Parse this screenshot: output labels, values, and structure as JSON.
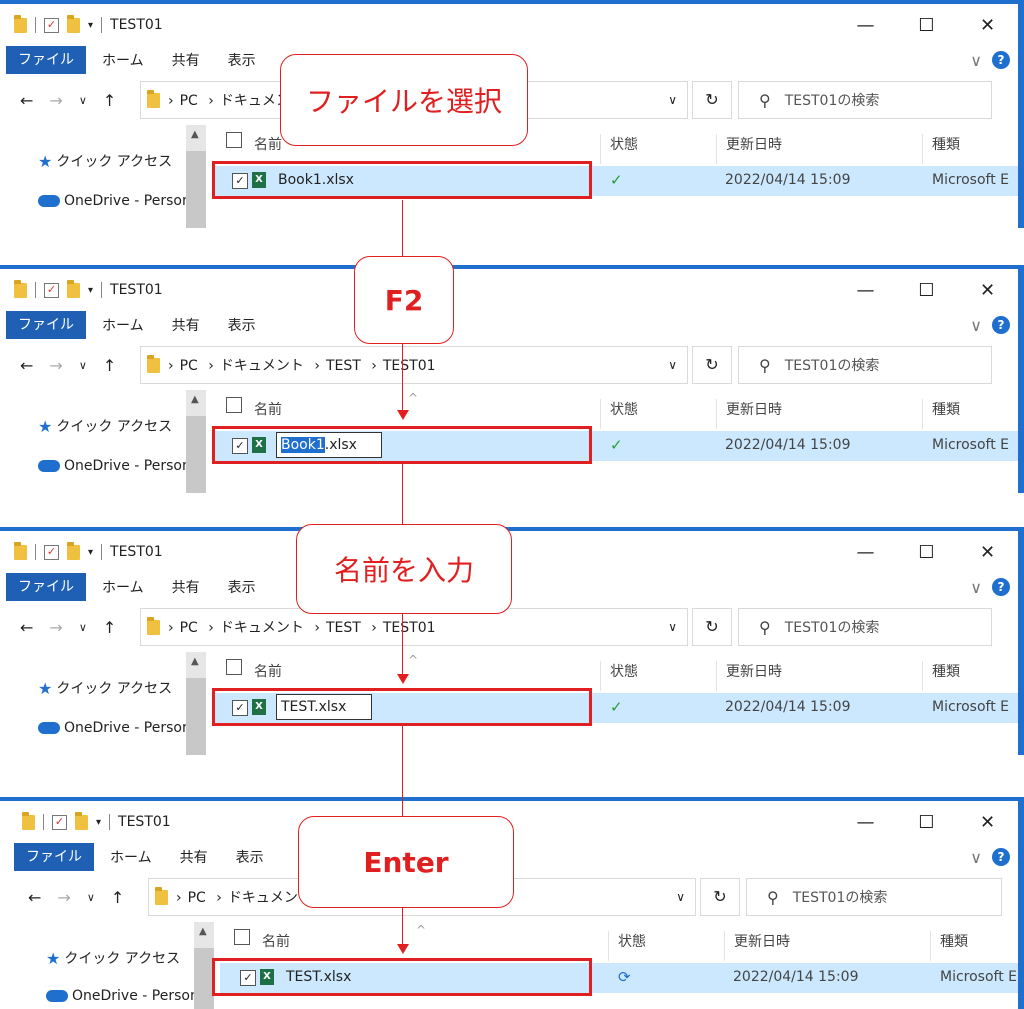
{
  "panels": [
    {
      "title": "TEST01",
      "ribbon": {
        "file": "ファイル",
        "home": "ホーム",
        "share": "共有",
        "view": "表示"
      },
      "crumbs": [
        "PC",
        "ドキュメント"
      ],
      "search_placeholder": "TEST01の検索",
      "nav": {
        "quick": "クイック アクセス",
        "onedrive": "OneDrive - Person"
      },
      "columns": {
        "name": "名前",
        "status": "状態",
        "date": "更新日時",
        "type": "種類"
      },
      "file": {
        "name": "Book1.xlsx",
        "date": "2022/04/14 15:09",
        "type": "Microsoft E",
        "status_icon": "check-circle"
      }
    },
    {
      "title": "TEST01",
      "ribbon": {
        "file": "ファイル",
        "home": "ホーム",
        "share": "共有",
        "view": "表示"
      },
      "crumbs": [
        "PC",
        "ドキュメント",
        "TEST",
        "TEST01"
      ],
      "search_placeholder": "TEST01の検索",
      "nav": {
        "quick": "クイック アクセス",
        "onedrive": "OneDrive - Person"
      },
      "columns": {
        "name": "名前",
        "status": "状態",
        "date": "更新日時",
        "type": "種類"
      },
      "file": {
        "name_selected": "Book1",
        "name_rest": ".xlsx",
        "date": "2022/04/14 15:09",
        "type": "Microsoft E",
        "status_icon": "check-circle"
      }
    },
    {
      "title": "TEST01",
      "ribbon": {
        "file": "ファイル",
        "home": "ホーム",
        "share": "共有",
        "view": "表示"
      },
      "crumbs": [
        "PC",
        "ドキュメント",
        "TEST",
        "TEST01"
      ],
      "search_placeholder": "TEST01の検索",
      "nav": {
        "quick": "クイック アクセス",
        "onedrive": "OneDrive - Person"
      },
      "columns": {
        "name": "名前",
        "status": "状態",
        "date": "更新日時",
        "type": "種類"
      },
      "file": {
        "name_edit": "TEST.xlsx",
        "date": "2022/04/14 15:09",
        "type": "Microsoft E",
        "status_icon": "check-circle"
      }
    },
    {
      "title": "TEST01",
      "ribbon": {
        "file": "ファイル",
        "home": "ホーム",
        "share": "共有",
        "view": "表示"
      },
      "crumbs": [
        "PC",
        "ドキュメント"
      ],
      "search_placeholder": "TEST01の検索",
      "nav": {
        "quick": "クイック アクセス",
        "onedrive": "OneDrive - Person"
      },
      "columns": {
        "name": "名前",
        "status": "状態",
        "date": "更新日時",
        "type": "種類"
      },
      "file": {
        "name": "TEST.xlsx",
        "date": "2022/04/14 15:09",
        "type": "Microsoft E",
        "status_icon": "sync"
      }
    }
  ],
  "callouts": [
    "ファイルを選択",
    "F2",
    "名前を入力",
    "Enter"
  ],
  "colors": {
    "highlight": "#e02020",
    "accent": "#1f6fcf",
    "row_selected": "#cce8ff"
  }
}
